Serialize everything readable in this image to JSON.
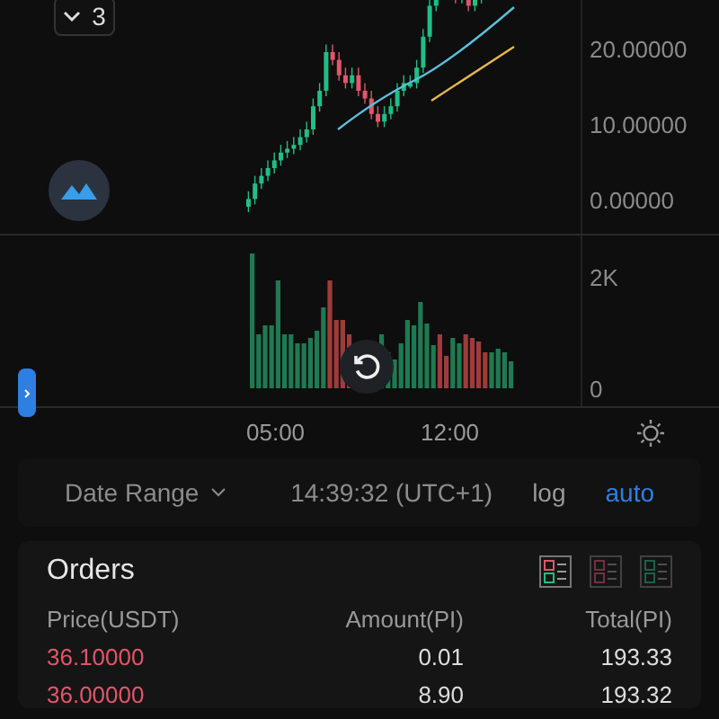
{
  "indicator_toggle": {
    "count": "3"
  },
  "price_axis": [
    "20.00000",
    "10.00000",
    "0.00000"
  ],
  "volume_axis": [
    "2K",
    "0"
  ],
  "time_axis": [
    "05:00",
    "12:00"
  ],
  "toolbar": {
    "date_range": "Date Range",
    "clock": "14:39:32 (UTC+1)",
    "scales": [
      {
        "label": "log",
        "selected": false
      },
      {
        "label": "auto",
        "selected": true
      }
    ]
  },
  "orders": {
    "title": "Orders",
    "views": [
      {
        "kind": "both",
        "selected": true
      },
      {
        "kind": "asks",
        "selected": false
      },
      {
        "kind": "bids",
        "selected": false
      }
    ],
    "columns": [
      "Price(USDT)",
      "Amount(PI)",
      "Total(PI)"
    ],
    "rows": [
      {
        "price": "36.10000",
        "amount": "0.01",
        "total": "193.33"
      },
      {
        "price": "36.00000",
        "amount": "8.90",
        "total": "193.32"
      }
    ]
  }
}
